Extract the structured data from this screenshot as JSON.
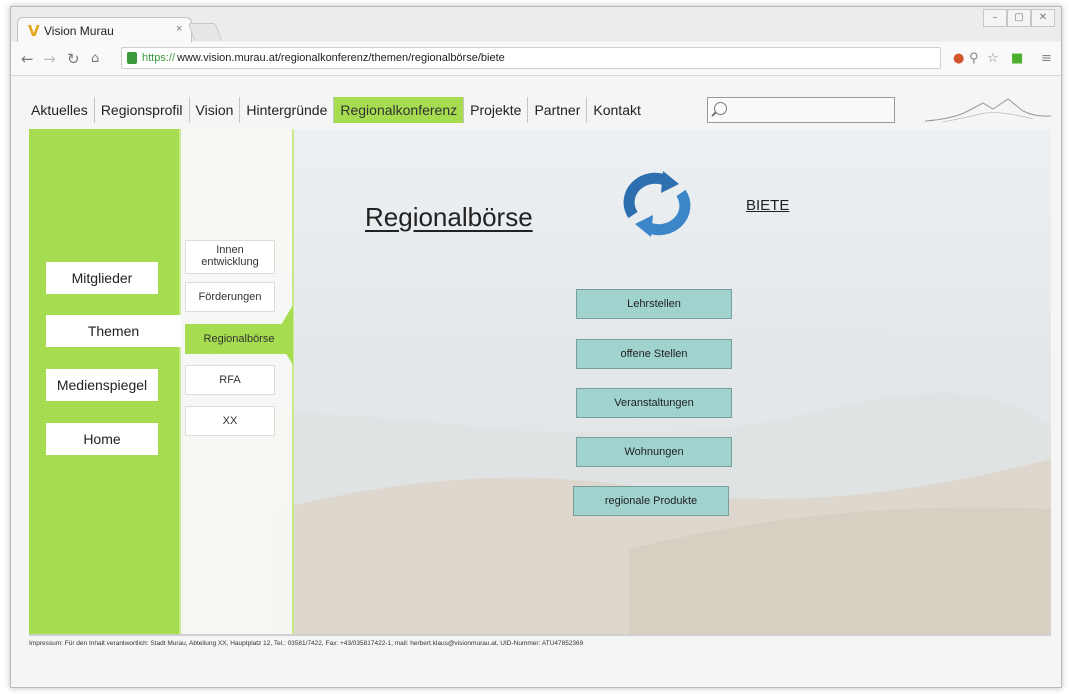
{
  "browser": {
    "tab_title": "Vision Murau",
    "tab_close": "×",
    "favicon": "V",
    "url_scheme": "https://",
    "url_rest": "www.vision.murau.at/regionalkonferenz/themen/regionalbörse/biete",
    "icons": [
      "back-icon",
      "forward-icon",
      "reload-icon",
      "home-icon",
      "lock-icon",
      "star-icon",
      "menu-icon"
    ]
  },
  "topnav": {
    "items": [
      "Aktuelles",
      "Regionsprofil",
      "Vision",
      "Hintergründe",
      "Regionalkonferenz",
      "Projekte",
      "Partner",
      "Kontakt"
    ],
    "active": "Regionalkonferenz",
    "search_placeholder": ""
  },
  "main_menu": {
    "items": [
      "Mitglieder",
      "Themen",
      "Medienspiegel",
      "Home"
    ],
    "active": "Themen"
  },
  "sub_menu": {
    "items": [
      "Innen entwicklung",
      "Förderungen",
      "Regionalbörse",
      "RFA",
      "XX"
    ],
    "active": "Regionalbörse"
  },
  "content": {
    "heading": "Regionalbörse",
    "biete": "BIETE",
    "buttons": [
      "Lehrstellen",
      "offene Stellen",
      "Veranstaltungen",
      "Wohnungen",
      "regionale Produkte"
    ]
  },
  "footer": "Impressum: Für den Inhalt verantwortlich: Stadt Murau, Abteilung XX, Hauptplatz 12, Tel.: 03581/7422, Fax: +43/035817422-1, mail: herbert.klaus@visionmurau.at, UID-Nummer: ATU47852369",
  "colors": {
    "accent_green": "#a6dc4f",
    "teal_button": "#a0d3cd",
    "cycle_icon_blue": "#2e6fb0"
  }
}
